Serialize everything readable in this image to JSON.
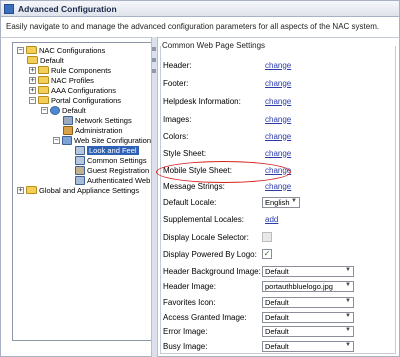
{
  "window": {
    "title": "Advanced Configuration"
  },
  "description": "Easily navigate to and manage the advanced configuration parameters for all aspects of the NAC system.",
  "tree": {
    "nodes": [
      {
        "label": "NAC Configurations",
        "icon": "folder-icon",
        "toggle": "−"
      },
      {
        "label": "Default",
        "icon": "folder-icon",
        "toggle": "−"
      },
      {
        "label": "Rule Components",
        "icon": "folder-icon",
        "toggle": "+"
      },
      {
        "label": "NAC Profiles",
        "icon": "folder-icon",
        "toggle": "+"
      },
      {
        "label": "AAA Configurations",
        "icon": "folder-icon",
        "toggle": "+"
      },
      {
        "label": "Portal Configurations",
        "icon": "folder-icon",
        "toggle": "−"
      },
      {
        "label": "Default",
        "icon": "globe-icon",
        "toggle": "−"
      },
      {
        "label": "Network Settings",
        "icon": "network-icon",
        "toggle": ""
      },
      {
        "label": "Administration",
        "icon": "admin-icon",
        "toggle": ""
      },
      {
        "label": "Web Site Configuration",
        "icon": "website-icon",
        "toggle": "−"
      },
      {
        "label": "Look and Feel",
        "icon": "look-feel-icon",
        "toggle": ""
      },
      {
        "label": "Common Settings",
        "icon": "settings-icon",
        "toggle": ""
      },
      {
        "label": "Guest Registration",
        "icon": "guest-icon",
        "toggle": ""
      },
      {
        "label": "Authenticated Web",
        "icon": "user-icon",
        "toggle": ""
      },
      {
        "label": "Global and Appliance Settings",
        "icon": "folder-icon",
        "toggle": "+"
      }
    ],
    "selected": "Look and Feel"
  },
  "panel": {
    "title": "Common Web Page Settings",
    "rows": [
      {
        "label": "Header:",
        "value": "change"
      },
      {
        "label": "Footer:",
        "value": "change"
      },
      {
        "label": "Helpdesk Information:",
        "value": "change"
      },
      {
        "label": "Images:",
        "value": "change"
      },
      {
        "label": "Colors:",
        "value": "change"
      },
      {
        "label": "Style Sheet:",
        "value": "change"
      },
      {
        "label": "Mobile Style Sheet:",
        "value": "change"
      },
      {
        "label": "Message Strings:",
        "value": "change"
      }
    ],
    "default_locale": {
      "label": "Default Locale:",
      "value": "English"
    },
    "supplemental_locales": {
      "label": "Supplemental Locales:",
      "value": "add"
    },
    "display_locale_selector": {
      "label": "Display Locale Selector:"
    },
    "display_powered_by_logo": {
      "label": "Display Powered By Logo:",
      "checkmark": "✓"
    },
    "selects": [
      {
        "label": "Header Background Image:",
        "value": "Default"
      },
      {
        "label": "Header Image:",
        "value": "portauthbluelogo.jpg"
      },
      {
        "label": "Favorites Icon:",
        "value": "Default"
      },
      {
        "label": "Access Granted Image:",
        "value": "Default"
      },
      {
        "label": "Error Image:",
        "value": "Default"
      },
      {
        "label": "Busy Image:",
        "value": "Default"
      }
    ]
  },
  "colors": {
    "link": "#2a3ba8",
    "highlight": "#d61f1f",
    "selection": "#2f62b5"
  }
}
